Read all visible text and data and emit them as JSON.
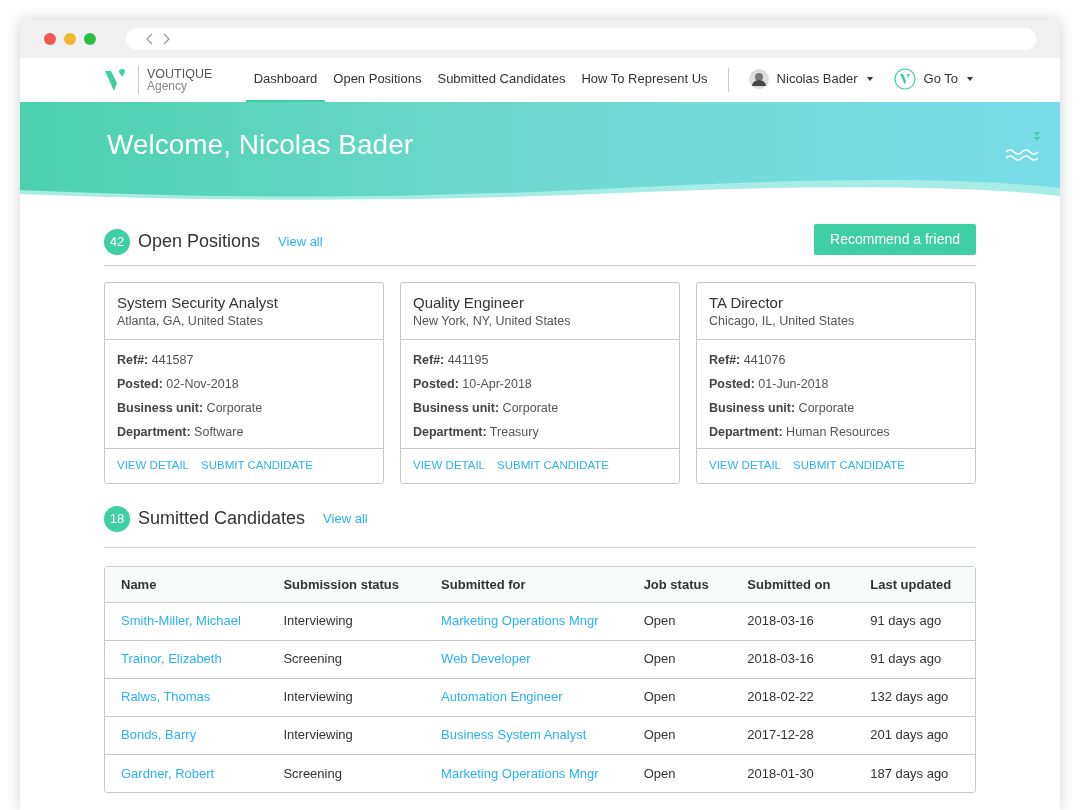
{
  "brand": {
    "name": "VOUTIQUE",
    "subtitle": "Agency"
  },
  "nav": {
    "items": [
      {
        "label": "Dashboard",
        "selected": true
      },
      {
        "label": "Open Positions",
        "selected": false
      },
      {
        "label": "Submitted Candidates",
        "selected": false
      },
      {
        "label": "How To Represent Us",
        "selected": false
      }
    ],
    "user": {
      "name": "Nicolas Bader"
    },
    "goto": {
      "label": "Go To"
    }
  },
  "hero": {
    "title": "Welcome, Nicolas Bader"
  },
  "open_positions": {
    "count": "42",
    "title": "Open Positions",
    "view_all": "View all",
    "action": "Recommend a friend",
    "cards": [
      {
        "title": "System Security Analyst",
        "location": "Atlanta, GA, United States",
        "fields": [
          {
            "label": "Ref#:",
            "value": "441587"
          },
          {
            "label": "Posted:",
            "value": "02-Nov-2018"
          },
          {
            "label": "Business unit:",
            "value": "Corporate"
          },
          {
            "label": "Department:",
            "value": "Software"
          }
        ],
        "actions": [
          "VIEW DETAIL",
          "SUBMIT CANDIDATE"
        ]
      },
      {
        "title": "Quality Engineer",
        "location": "New York, NY, United States",
        "fields": [
          {
            "label": "Ref#:",
            "value": "441195"
          },
          {
            "label": "Posted:",
            "value": "10-Apr-2018"
          },
          {
            "label": "Business unit:",
            "value": "Corporate"
          },
          {
            "label": "Department:",
            "value": "Treasury"
          }
        ],
        "actions": [
          "VIEW DETAIL",
          "SUBMIT CANDIDATE"
        ]
      },
      {
        "title": "TA Director",
        "location": "Chicago, IL, United States",
        "fields": [
          {
            "label": "Ref#:",
            "value": "441076"
          },
          {
            "label": "Posted:",
            "value": "01-Jun-2018"
          },
          {
            "label": "Business unit:",
            "value": "Corporate"
          },
          {
            "label": "Department:",
            "value": "Human Resources"
          }
        ],
        "actions": [
          "VIEW DETAIL",
          "SUBMIT CANDIDATE"
        ]
      }
    ]
  },
  "candidates": {
    "count": "18",
    "title": "Sumitted Candidates",
    "view_all": "View all",
    "table": {
      "columns": [
        {
          "label": "Name",
          "link": true
        },
        {
          "label": "Submission status",
          "link": false
        },
        {
          "label": "Submitted for",
          "link": true
        },
        {
          "label": "Job status",
          "link": false
        },
        {
          "label": "Submitted on",
          "link": false
        },
        {
          "label": "Last updated",
          "link": false
        }
      ],
      "rows": [
        [
          "Smith-Miller, Michael",
          "Interviewing",
          "Marketing Operations Mngr",
          "Open",
          "2018-03-16",
          "91 days ago"
        ],
        [
          "Trainor, Elizabeth",
          "Screening",
          "Web Developer",
          "Open",
          "2018-03-16",
          "91 days ago"
        ],
        [
          "Ralws, Thomas",
          "Interviewing",
          "Automation Engineer",
          "Open",
          "2018-02-22",
          "132 days ago"
        ],
        [
          "Bonds, Barry",
          "Interviewing",
          "Business System Analyst",
          "Open",
          "2017-12-28",
          "201 days ago"
        ],
        [
          "Gardner, Robert",
          "Screening",
          "Marketing Operations Mngr",
          "Open",
          "2018-01-30",
          "187 days ago"
        ]
      ]
    }
  }
}
